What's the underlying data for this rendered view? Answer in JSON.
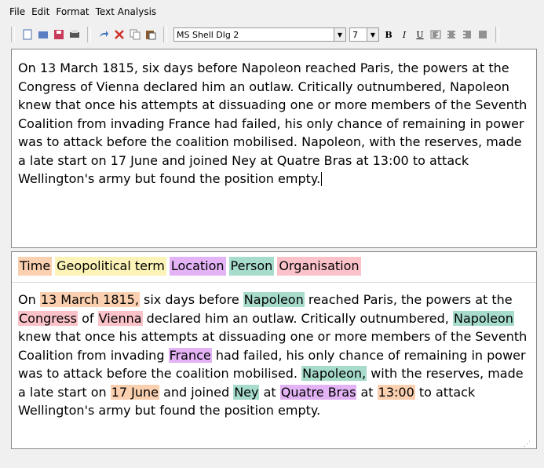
{
  "menu": [
    "File",
    "Edit",
    "Format",
    "Text Analysis"
  ],
  "toolbar": {
    "font": "MS Shell Dlg 2",
    "size": "7",
    "bold": "B",
    "italic": "I",
    "underline": "U"
  },
  "editor_text": "On 13 March 1815, six days before Napoleon reached Paris, the powers at the Congress of Vienna declared him an outlaw. Critically outnumbered, Napoleon knew that once his attempts at dissuading one or more members of the Seventh Coalition from invading France had failed, his only chance of remaining in power was to attack before the coalition mobilised. Napoleon, with the reserves, made a late start on 17 June and joined Ney at Quatre Bras at 13:00 to attack Wellington's army but found the position empty.",
  "legend": {
    "time": "Time",
    "geo": "Geopolitical term",
    "location": "Location",
    "person": "Person",
    "organisation": "Organisation"
  },
  "colors": {
    "time": "#fbd0b0",
    "geo": "#fbf3b8",
    "location": "#e3b3f5",
    "person": "#a7dccc",
    "organisation": "#fbc3c9"
  },
  "segments": [
    {
      "t": "On ",
      "c": ""
    },
    {
      "t": "13 March 1815,",
      "c": "time"
    },
    {
      "t": " six days before ",
      "c": ""
    },
    {
      "t": "Napoleon",
      "c": "per"
    },
    {
      "t": " reached Paris, the powers at the ",
      "c": ""
    },
    {
      "t": "Congress",
      "c": "org"
    },
    {
      "t": " of ",
      "c": ""
    },
    {
      "t": "Vienna",
      "c": "org"
    },
    {
      "t": " declared him an outlaw. Critically outnumbered, ",
      "c": ""
    },
    {
      "t": "Napoleon",
      "c": "per"
    },
    {
      "t": " knew that once his attempts at dissuading one or more members of the Seventh Coalition from invading ",
      "c": ""
    },
    {
      "t": "France",
      "c": "loc"
    },
    {
      "t": " had failed, his only chance of remaining in power was to attack before the coalition mobilised. ",
      "c": ""
    },
    {
      "t": "Napoleon,",
      "c": "per"
    },
    {
      "t": " with the reserves, made a late start on ",
      "c": ""
    },
    {
      "t": "17 June",
      "c": "time"
    },
    {
      "t": " and joined ",
      "c": ""
    },
    {
      "t": "Ney",
      "c": "per"
    },
    {
      "t": " at ",
      "c": ""
    },
    {
      "t": "Quatre Bras",
      "c": "loc"
    },
    {
      "t": " at ",
      "c": ""
    },
    {
      "t": "13:00",
      "c": "time"
    },
    {
      "t": " to attack Wellington's army but found the position empty.",
      "c": ""
    }
  ]
}
